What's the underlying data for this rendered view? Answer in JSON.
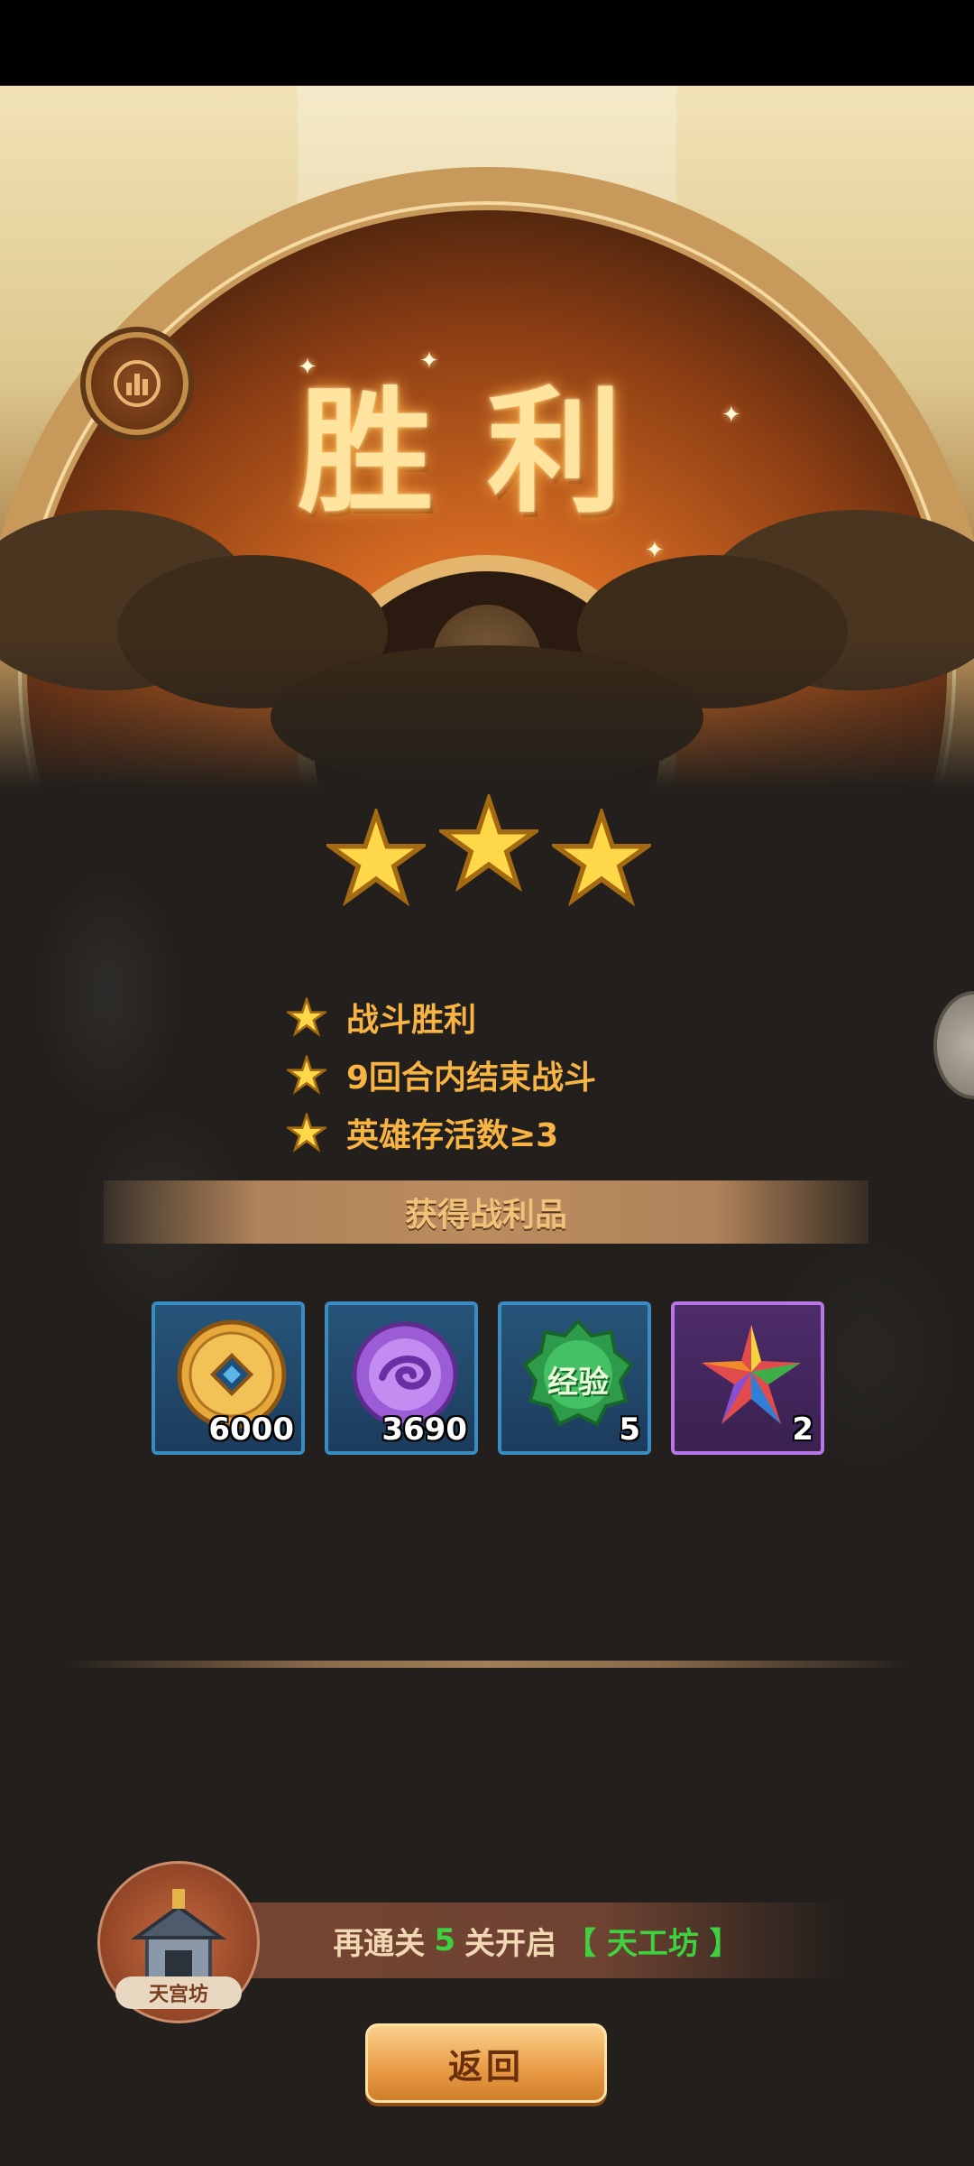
{
  "header": {
    "title": "胜利",
    "stats_button": "stats-icon"
  },
  "stars": {
    "earned": 3,
    "total": 3
  },
  "conditions": [
    {
      "label": "战斗胜利",
      "achieved": true
    },
    {
      "label": "9回合内结束战斗",
      "achieved": true
    },
    {
      "label": "英雄存活数≥3",
      "achieved": true
    }
  ],
  "loot": {
    "title": "获得战利品",
    "items": [
      {
        "icon": "gold-coin-icon",
        "quantity": "6000",
        "rarity": "blue"
      },
      {
        "icon": "purple-orb-icon",
        "quantity": "3690",
        "rarity": "blue"
      },
      {
        "icon": "exp-badge-icon",
        "icon_text": "经验",
        "quantity": "5",
        "rarity": "blue"
      },
      {
        "icon": "rainbow-star-crystal-icon",
        "quantity": "2",
        "rarity": "purple"
      }
    ]
  },
  "unlock": {
    "prefix": "再通关",
    "count": "5",
    "suffix": "关开启",
    "feature": "【 天工坊 】",
    "icon_label": "天宫坊"
  },
  "back_button": {
    "label": "返回"
  },
  "colors": {
    "condition_text": "#f7b443",
    "unlock_highlight": "#3fd13f",
    "star": "#ffd84a"
  }
}
